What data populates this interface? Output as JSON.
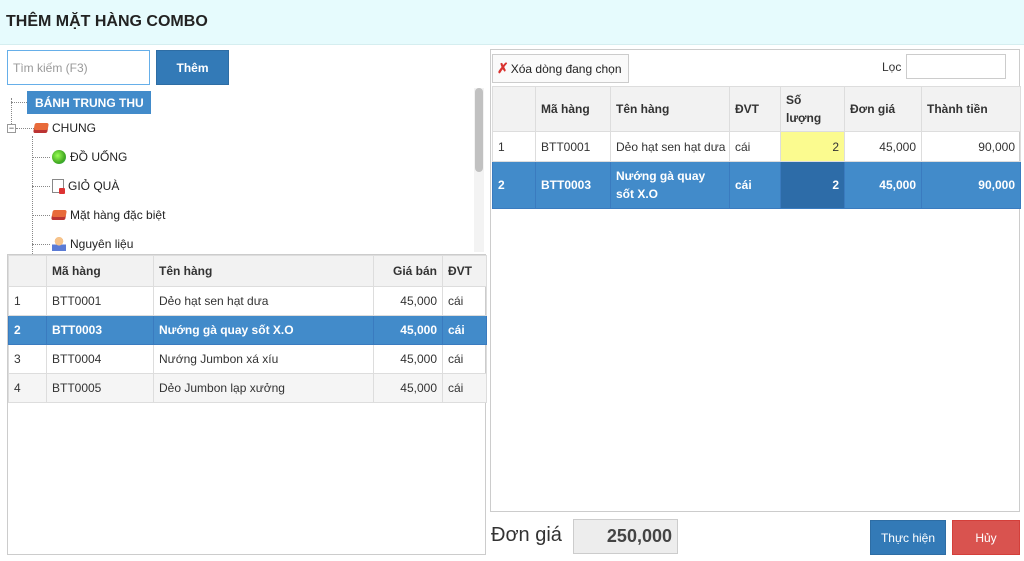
{
  "dialog": {
    "title": "THÊM MẶT HÀNG COMBO"
  },
  "search": {
    "placeholder": "Tìm kiếm (F3)",
    "add_label": "Thêm"
  },
  "tree": {
    "root": "BÁNH TRUNG THU",
    "expander": "−",
    "group": {
      "label": "CHUNG",
      "icon": "book-icon"
    },
    "children": [
      {
        "label": "ĐỒ UỐNG",
        "icon": "fruit-icon"
      },
      {
        "label": "GIỎ QUÀ",
        "icon": "document-icon"
      },
      {
        "label": "Mặt hàng đặc biệt",
        "icon": "book-icon"
      },
      {
        "label": "Nguyên liệu",
        "icon": "user-icon"
      }
    ]
  },
  "product_table": {
    "headers": [
      "",
      "Mã hàng",
      "Tên hàng",
      "Giá bán",
      "ĐVT"
    ],
    "rows": [
      [
        "1",
        "BTT0001",
        "Dẻo hạt sen hạt dưa",
        "45,000",
        "cái"
      ],
      [
        "2",
        "BTT0003",
        "Nướng gà quay sốt X.O",
        "45,000",
        "cái"
      ],
      [
        "3",
        "BTT0004",
        "Nướng Jumbon xá xíu",
        "45,000",
        "cái"
      ],
      [
        "4",
        "BTT0005",
        "Dẻo Jumbon lạp xưởng",
        "45,000",
        "cái"
      ]
    ],
    "selected_index": 1
  },
  "combo": {
    "delete_label": "Xóa dòng đang chọn",
    "filter_label": "Lọc",
    "headers": [
      "",
      "Mã hàng",
      "Tên hàng",
      "ĐVT",
      "Số lượng",
      "Đơn giá",
      "Thành tiền"
    ],
    "rows": [
      [
        "1",
        "BTT0001",
        "Dẻo hạt sen hạt dưa",
        "cái",
        "2",
        "45,000",
        "90,000"
      ],
      [
        "2",
        "BTT0003",
        "Nướng gà quay sốt X.O",
        "cái",
        "2",
        "45,000",
        "90,000"
      ]
    ],
    "selected_index": 1
  },
  "footer": {
    "price_label": "Đơn giá",
    "price_value": "250,000",
    "ok_label": "Thực hiện",
    "cancel_label": "Hủy"
  },
  "colors": {
    "accent": "#337ab7",
    "selected_row": "#428bca",
    "danger": "#d9534f",
    "title_bg": "#e6fbfd",
    "qty_highlight": "#fbfb8f"
  }
}
